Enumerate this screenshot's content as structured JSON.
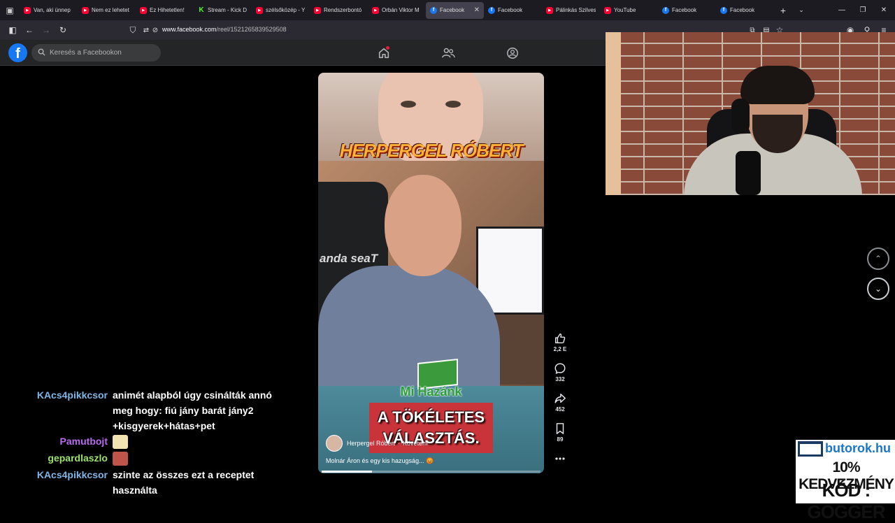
{
  "tabs": [
    {
      "label": "Van, aki ünnep",
      "icon": "youtube-icon"
    },
    {
      "label": "Nem ez lehetet",
      "icon": "youtube-icon"
    },
    {
      "label": "Ez Hihetetlen!",
      "icon": "youtube-icon"
    },
    {
      "label": "Stream - Kick D",
      "icon": "kick-icon"
    },
    {
      "label": "szélsőközép - Y",
      "icon": "youtube-icon"
    },
    {
      "label": "Rendszerbontó",
      "icon": "youtube-icon"
    },
    {
      "label": "Orbán Viktor M",
      "icon": "youtube-icon"
    },
    {
      "label": "Facebook",
      "icon": "facebook-icon",
      "active": true
    },
    {
      "label": "Facebook",
      "icon": "facebook-icon"
    },
    {
      "label": "Pálinkás Szilves",
      "icon": "youtube-icon"
    },
    {
      "label": "YouTube",
      "icon": "youtube-icon"
    },
    {
      "label": "Facebook",
      "icon": "facebook-icon"
    },
    {
      "label": "Facebook",
      "icon": "facebook-icon"
    }
  ],
  "address": {
    "host": "www.facebook.com",
    "path": "/reel/1521265839529508"
  },
  "facebook": {
    "logo": "f",
    "search_placeholder": "Keresés a Facebookon"
  },
  "reel": {
    "overlay_name": "HERPERGEL RÓBERT",
    "brand": "Mi Hazánk",
    "headline_1": "A TÖKÉLETES",
    "headline_2": "VÁLASZTÁS.",
    "author": "Herpergel Róbert",
    "follow": "Követem",
    "caption": "Molnár Áron és egy kis hazugság... 😡",
    "progress_fraction": 0.23,
    "actions": [
      {
        "icon": "like-icon",
        "label": "2,2 E"
      },
      {
        "icon": "comment-icon",
        "label": "332"
      },
      {
        "icon": "share-icon",
        "label": "452"
      },
      {
        "icon": "bookmark-icon",
        "label": "89"
      },
      {
        "icon": "more-icon",
        "label": ""
      }
    ]
  },
  "chat": [
    {
      "user": "KAcs4pikkcsor",
      "color": "#7eb6e8",
      "text": "animét alapból úgy csinálták annó meg hogy: fiú jány barát jány2 +kisgyerek+hátas+pet"
    },
    {
      "user": "Pamutbojt",
      "color": "#b86cf0",
      "text": "",
      "emote_color": "#f3e3b0"
    },
    {
      "user": "gepardlaszlo",
      "color": "#9be36a",
      "text": "",
      "emote_color": "#c0544a"
    },
    {
      "user": "KAcs4pikkcsor",
      "color": "#7eb6e8",
      "text": "szinte az összes ezt a receptet használta"
    }
  ],
  "ad": {
    "site": "butorok.hu",
    "line1": "10% KEDVEZMÉNY",
    "line2": "KÓD : GOGGER"
  }
}
